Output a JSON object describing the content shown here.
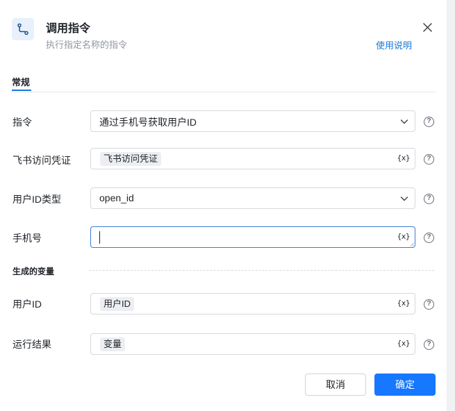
{
  "header": {
    "title": "调用指令",
    "subtitle": "执行指定名称的指令",
    "help_link": "使用说明",
    "icon": "flow-icon"
  },
  "tabs": [
    {
      "label": "常规",
      "active": true
    }
  ],
  "fields": {
    "command": {
      "label": "指令",
      "value": "通过手机号获取用户ID"
    },
    "credential": {
      "label": "飞书访问凭证",
      "chip": "飞书访问凭证",
      "var_label": "{x}"
    },
    "id_type": {
      "label": "用户ID类型",
      "value": "open_id"
    },
    "phone": {
      "label": "手机号",
      "value": "",
      "var_label": "{x}"
    }
  },
  "output_section": {
    "title": "生成的变量",
    "user_id": {
      "label": "用户ID",
      "chip": "用户ID",
      "var_label": "{x}"
    },
    "run_result": {
      "label": "运行结果",
      "chip": "变量",
      "var_label": "{x}"
    }
  },
  "help_icon_glyph": "?",
  "footer": {
    "cancel_label": "取消",
    "ok_label": "确定"
  },
  "colors": {
    "accent": "#1677ff",
    "link": "#1677d9",
    "icon_bg": "#e8f0fb"
  }
}
